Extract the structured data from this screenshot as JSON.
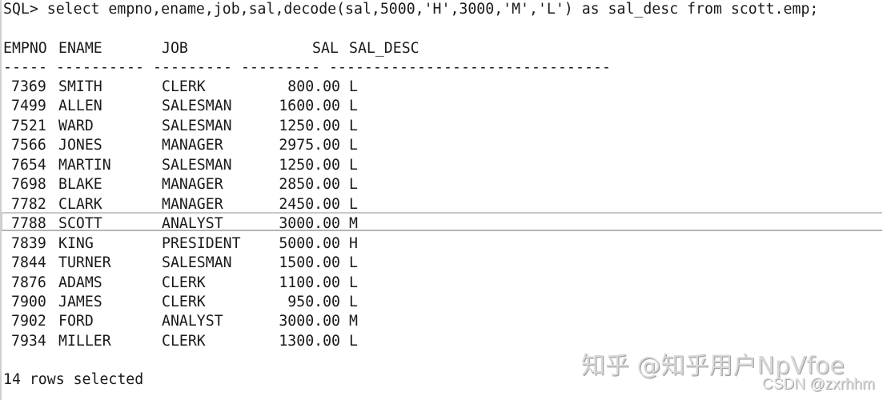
{
  "console": {
    "prompt": "SQL>",
    "command": "select empno,ename,job,sal,decode(sal,5000,'H',3000,'M','L') as sal_desc from scott.emp;",
    "columns": [
      "EMPNO",
      "ENAME",
      "JOB",
      "SAL",
      "SAL_DESC"
    ],
    "separator": "----- ---------- --------- --------- --------------------------------",
    "rows": [
      {
        "empno": "7369",
        "ename": "SMITH",
        "job": "CLERK",
        "sal": "800.00",
        "sal_desc": "L"
      },
      {
        "empno": "7499",
        "ename": "ALLEN",
        "job": "SALESMAN",
        "sal": "1600.00",
        "sal_desc": "L"
      },
      {
        "empno": "7521",
        "ename": "WARD",
        "job": "SALESMAN",
        "sal": "1250.00",
        "sal_desc": "L"
      },
      {
        "empno": "7566",
        "ename": "JONES",
        "job": "MANAGER",
        "sal": "2975.00",
        "sal_desc": "L"
      },
      {
        "empno": "7654",
        "ename": "MARTIN",
        "job": "SALESMAN",
        "sal": "1250.00",
        "sal_desc": "L"
      },
      {
        "empno": "7698",
        "ename": "BLAKE",
        "job": "MANAGER",
        "sal": "2850.00",
        "sal_desc": "L"
      },
      {
        "empno": "7782",
        "ename": "CLARK",
        "job": "MANAGER",
        "sal": "2450.00",
        "sal_desc": "L"
      },
      {
        "empno": "7788",
        "ename": "SCOTT",
        "job": "ANALYST",
        "sal": "3000.00",
        "sal_desc": "M"
      },
      {
        "empno": "7839",
        "ename": "KING",
        "job": "PRESIDENT",
        "sal": "5000.00",
        "sal_desc": "H"
      },
      {
        "empno": "7844",
        "ename": "TURNER",
        "job": "SALESMAN",
        "sal": "1500.00",
        "sal_desc": "L"
      },
      {
        "empno": "7876",
        "ename": "ADAMS",
        "job": "CLERK",
        "sal": "1100.00",
        "sal_desc": "L"
      },
      {
        "empno": "7900",
        "ename": "JAMES",
        "job": "CLERK",
        "sal": "950.00",
        "sal_desc": "L"
      },
      {
        "empno": "7902",
        "ename": "FORD",
        "job": "ANALYST",
        "sal": "3000.00",
        "sal_desc": "M"
      },
      {
        "empno": "7934",
        "ename": "MILLER",
        "job": "CLERK",
        "sal": "1300.00",
        "sal_desc": "L"
      }
    ],
    "highlighted_row_index": 7,
    "footer": "14 rows selected"
  },
  "watermark": {
    "main": "知乎 @知乎用户NpVfoe",
    "sub": "CSDN @zxrhhm"
  }
}
